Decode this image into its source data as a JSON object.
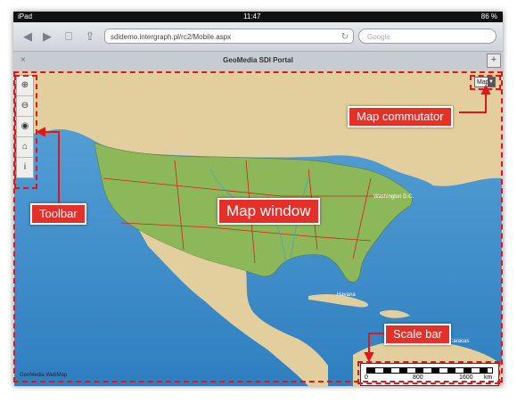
{
  "status": {
    "device": "iPad",
    "time": "11:47",
    "battery": "86 %"
  },
  "browser": {
    "url": "sdidemo.intergraph.pl/rc2/Mobile.aspx",
    "search_placeholder": "Google"
  },
  "tab": {
    "title": "GeoMedia SDI Portal",
    "close": "×",
    "add": "+"
  },
  "map": {
    "layer_select": "Map",
    "attribution": "GeoMedia WebMap",
    "scale_labels": [
      "0",
      "800",
      "1600",
      "km"
    ],
    "place_labels": [
      "Washington D.C.",
      "Havana",
      "Caracas"
    ]
  },
  "callouts": {
    "commutator": "Map commutator",
    "toolbar": "Toolbar",
    "window": "Map window",
    "scale": "Scale bar"
  },
  "icons": [
    "zoom-in-icon",
    "zoom-out-icon",
    "layers-icon",
    "home-icon",
    "info-icon"
  ],
  "colors": {
    "annotation": "#e3141b",
    "land": "#8db85a",
    "ocean": "#3e8fc9",
    "background_land": "#e3cf9d"
  }
}
